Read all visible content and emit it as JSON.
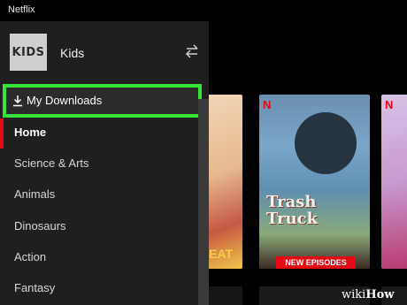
{
  "window": {
    "title": "Netflix"
  },
  "profile": {
    "avatar_text": "KIDS",
    "name": "Kids",
    "switch_icon": "switch-profile-icon"
  },
  "downloads": {
    "label": "My Downloads",
    "icon": "download-icon",
    "highlight_color": "#38e436"
  },
  "nav": {
    "items": [
      {
        "label": "Home",
        "active": true
      },
      {
        "label": "Science & Arts",
        "active": false
      },
      {
        "label": "Animals",
        "active": false
      },
      {
        "label": "Dinosaurs",
        "active": false
      },
      {
        "label": "Action",
        "active": false
      },
      {
        "label": "Fantasy",
        "active": false
      }
    ]
  },
  "posters": {
    "trash_truck_title": "Trash Truck",
    "new_episodes_badge": "NEW EPISODES",
    "beat_text": "BEAT",
    "netflix_n": "N"
  },
  "colors": {
    "accent": "#e50914",
    "sidebar_bg": "#1f1f1f",
    "highlight": "#38e436"
  },
  "watermark": {
    "prefix": "wiki",
    "suffix": "How"
  }
}
